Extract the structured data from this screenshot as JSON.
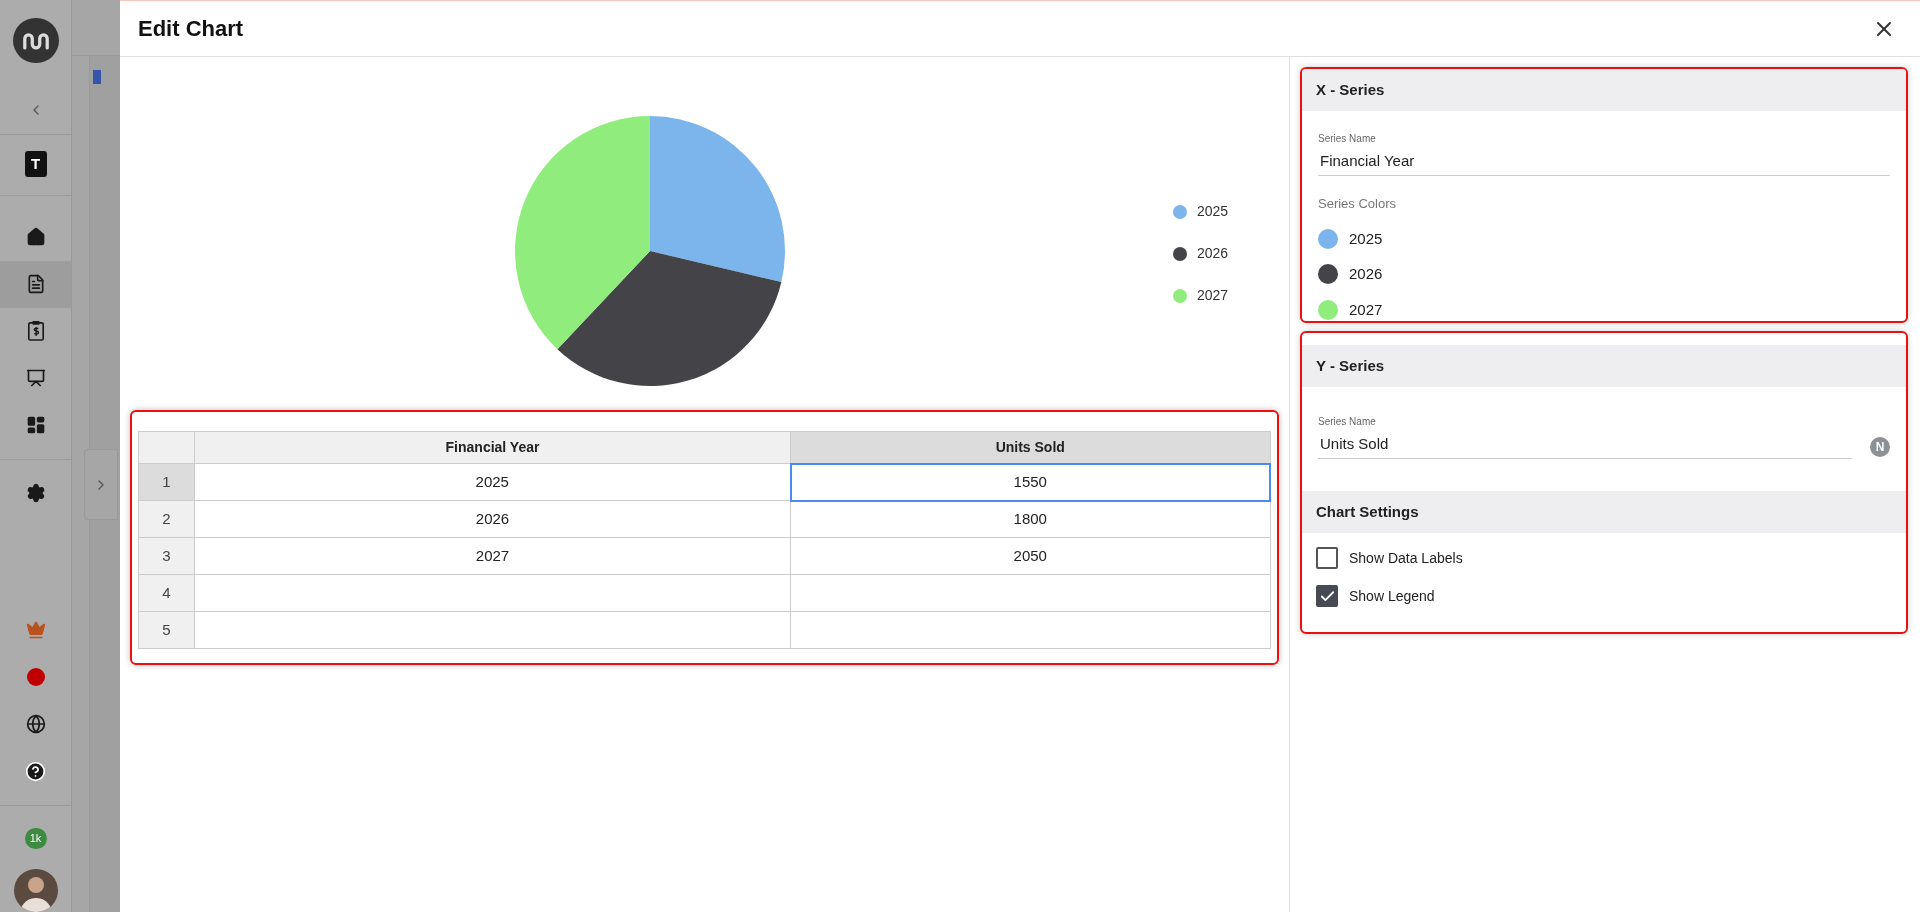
{
  "sidebar": {
    "workspace_letter": "T",
    "nav_items": [
      {
        "kind": "home",
        "selected": false
      },
      {
        "kind": "document",
        "selected": true
      },
      {
        "kind": "invoice",
        "selected": false
      },
      {
        "kind": "presentation",
        "selected": false
      },
      {
        "kind": "dashboard",
        "selected": false
      },
      {
        "kind": "settings",
        "selected": false
      }
    ],
    "bottom_items": [
      {
        "kind": "crown"
      },
      {
        "kind": "record"
      },
      {
        "kind": "globe"
      },
      {
        "kind": "help"
      }
    ],
    "count_badge": "1k"
  },
  "dialog": {
    "title": "Edit Chart",
    "chart": {
      "chart_data": {
        "type": "pie",
        "categories": [
          "2025",
          "2026",
          "2027"
        ],
        "values": [
          28.7,
          33.33,
          37.97
        ],
        "colors": [
          "#7cb5ec",
          "#434348",
          "#90ed7d"
        ]
      }
    },
    "table": {
      "columns": [
        {
          "label": "Financial Year",
          "selected": false
        },
        {
          "label": "Units Sold",
          "selected": true
        }
      ],
      "rows": [
        {
          "number": "1",
          "selected": true,
          "cells": [
            "2025",
            "1550"
          ]
        },
        {
          "number": "2",
          "selected": false,
          "cells": [
            "2026",
            "1800"
          ]
        },
        {
          "number": "3",
          "selected": false,
          "cells": [
            "2027",
            "2050"
          ]
        },
        {
          "number": "4",
          "selected": false,
          "cells": []
        },
        {
          "number": "5",
          "selected": false,
          "cells": []
        }
      ]
    },
    "x_series": {
      "title": "X - Series",
      "series_name_label": "Series Name",
      "series_name": "Financial Year",
      "colors_label": "Series Colors",
      "colors": [
        {
          "label": "2025",
          "color": "#7cb5ec"
        },
        {
          "label": "2026",
          "color": "#434348"
        },
        {
          "label": "2027",
          "color": "#90ed7d"
        }
      ]
    },
    "y_series": {
      "title": "Y - Series",
      "series_name_label": "Series Name",
      "series_name": "Units Sold",
      "badge": "N"
    },
    "chart_settings": {
      "title": "Chart Settings",
      "options": [
        {
          "label": "Show Data Labels",
          "checked": false
        },
        {
          "label": "Show Legend",
          "checked": true
        }
      ]
    }
  }
}
